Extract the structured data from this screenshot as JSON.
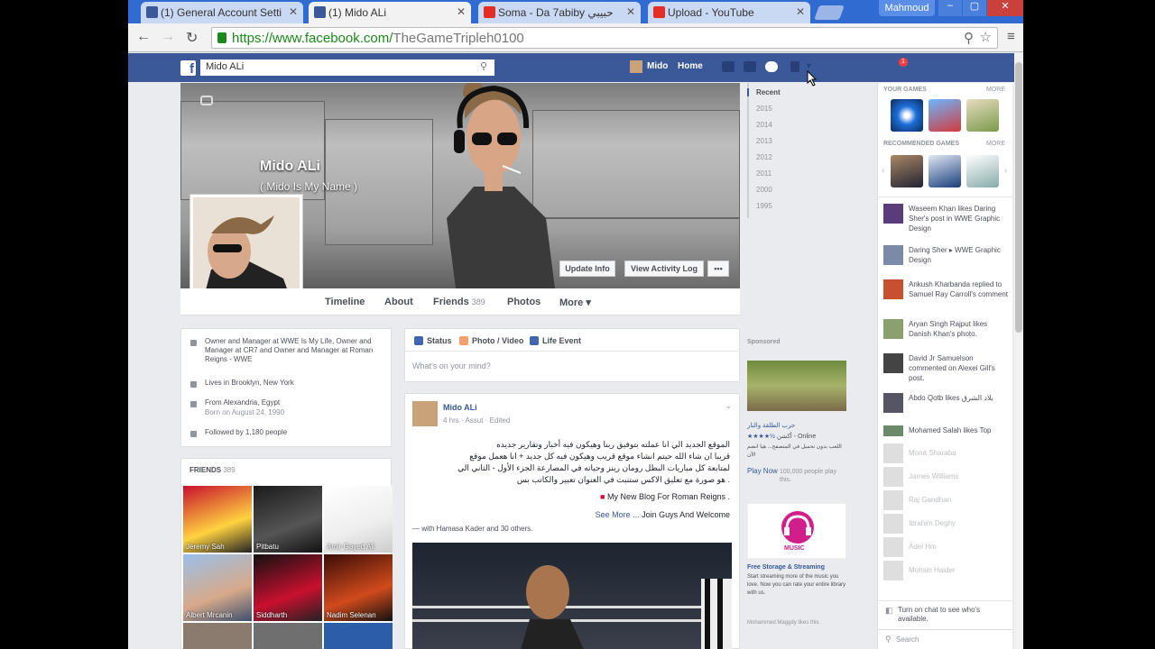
{
  "browser": {
    "tabs": [
      {
        "label": "(1) General Account Setti",
        "icon": "facebook-icon"
      },
      {
        "label": "(1) Mido ALi",
        "icon": "facebook-icon"
      },
      {
        "label": "Soma - Da 7abiby حبيبي",
        "icon": "youtube-icon"
      },
      {
        "label": "Upload - YouTube",
        "icon": "youtube-icon"
      }
    ],
    "user": "Mahmoud",
    "url_host": "https://www.facebook.com/",
    "url_path": "TheGameTripleh0100"
  },
  "fb": {
    "logo": "f",
    "search_value": "Mido ALi",
    "nav_user": "Mido",
    "nav_home": "Home",
    "notif_count": "1"
  },
  "profile": {
    "name": "Mido ALi",
    "alt_name": "( Mido Is My Name )",
    "update_info": "Update Info",
    "view_activity": "View Activity Log",
    "more_dots": "•••",
    "nav": [
      {
        "label": "Timeline"
      },
      {
        "label": "About"
      },
      {
        "label": "Friends",
        "count": "389"
      },
      {
        "label": "Photos"
      },
      {
        "label": "More ▾"
      }
    ]
  },
  "timeline_years": [
    "Recent",
    "2015",
    "2014",
    "2013",
    "2012",
    "2011",
    "2000",
    "1995"
  ],
  "intro": {
    "work": "Owner and Manager at WWE Is My Life, Owner and Manager at CR7 and Owner and Manager at Roman Reigns - WWE",
    "lives": "Lives in Brooklyn, New York",
    "from": "From Alexandria, Egypt",
    "born": "Born on August 24, 1990",
    "followed": "Followed by 1,180 people"
  },
  "friends": {
    "title": "FRIENDS",
    "count": "389",
    "items": [
      "Jeremy Sah",
      "Pitbatu",
      "Amir Gayed Ali",
      "Albert Mrcanin",
      "Siddharth",
      "Nadim Selenan"
    ]
  },
  "composer": {
    "tabs": [
      "Status",
      "Photo / Video",
      "Life Event"
    ],
    "placeholder": "What's on your mind?"
  },
  "post": {
    "author": "Mido ALi",
    "meta": "4 hrs · Assut · Edited",
    "lines": [
      "الموقع الجديد الي انا عملته بتوفيق ربنا وهيكون فيه أخبار وتقارير جديده",
      "قريبا ان شاء الله حيتم انشاء موقع قريب وهيكون فيه كل جديد + انا هعمل موقع",
      "لمتابعة كل مباريات البطل رومان رينز وحياته في المصارعة الجزء الأول - الثاني الي",
      "هو صورة مع تعليق الاكس ستنبت في العنوان تعبير والكاتب بس ."
    ],
    "blog": "My New Blog For Roman Reigns .",
    "see_more": "See More ...",
    "join": "Join Guys And Welcome",
    "with": "— with Hamasa Kader and 30 others."
  },
  "ads": {
    "sponsored": "Sponsored",
    "game_title": "حرب الطلقة والنار",
    "game_sub": "أكشن - Online",
    "game_desc": "اللعب بدون تحميل في المتصفح... هيا انضم الآن",
    "play_now": "Play Now",
    "players": "100,000 people play this.",
    "music_label": "MUSIC",
    "music_title": "Free Storage & Streaming",
    "music_desc": "Start streaming more of the music you love. Now you can rate your entire library with us.",
    "music_like": "Mohammed Maggdy likes this."
  },
  "right": {
    "your_games": "YOUR GAMES",
    "recommended": "RECOMMENDED GAMES",
    "more": "MORE",
    "ticker": [
      {
        "text": "Waseem Khan likes Daring Sher's post in WWE Graphic Design"
      },
      {
        "text": "Daring Sher ▸ WWE Graphic Design"
      },
      {
        "text": "Ankush Kharbanda replied to Samuel Ray Carroll's comment"
      },
      {
        "text": "Aryan Singh Rajput likes Danish Khan's photo."
      },
      {
        "text": "David Jr Samuelson commented on Alexei Gill's post."
      },
      {
        "text": "Abdo Qotb likes بلاد الشرق"
      },
      {
        "text": "Mohamed Salah likes Top"
      }
    ],
    "chat": [
      "Mona Sharaba",
      "James Williams",
      "Raj Gandhan",
      "Ibrahim Deghy",
      "Adel Hm",
      "Mohsin Haider"
    ],
    "chat_notice": "Turn on chat to see who's available.",
    "chat_search": "Search"
  }
}
